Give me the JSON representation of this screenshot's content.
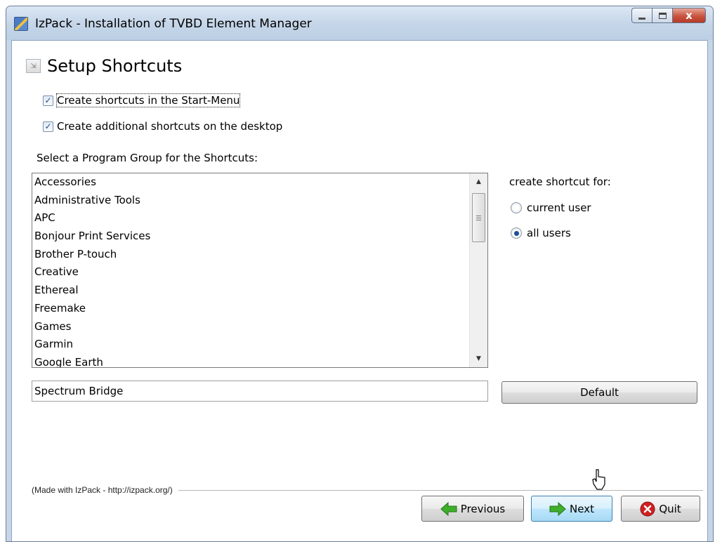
{
  "window": {
    "title": "IzPack - Installation of TVBD Element Manager",
    "controls": {
      "minimize": "minimize",
      "maximize": "maximize",
      "close": "x"
    }
  },
  "panel": {
    "heading": "Setup Shortcuts",
    "checkboxes": [
      {
        "label": "Create shortcuts in the Start-Menu",
        "checked": true
      },
      {
        "label": "Create additional shortcuts on the desktop",
        "checked": true
      }
    ],
    "group_label": "Select a Program Group for the Shortcuts:",
    "program_groups": [
      "Accessories",
      "Administrative Tools",
      "APC",
      "Bonjour Print Services",
      "Brother P-touch",
      "Creative",
      "Ethereal",
      "Freemake",
      "Games",
      "Garmin",
      "Google Earth"
    ],
    "shortcut_for": {
      "label": "create shortcut for:",
      "options": [
        "current user",
        "all users"
      ],
      "selected": "all users"
    },
    "group_name_value": "Spectrum Bridge",
    "default_button": "Default"
  },
  "footer": {
    "made_with": "(Made with IzPack - http://izpack.org/)",
    "previous": "Previous",
    "next": "Next",
    "quit": "Quit"
  },
  "colors": {
    "title_bar": "#c4d5e8",
    "close_button": "#c8533f",
    "next_button_highlight": "#bee6fd",
    "arrow_green": "#3fae2a",
    "quit_red": "#d02020"
  }
}
